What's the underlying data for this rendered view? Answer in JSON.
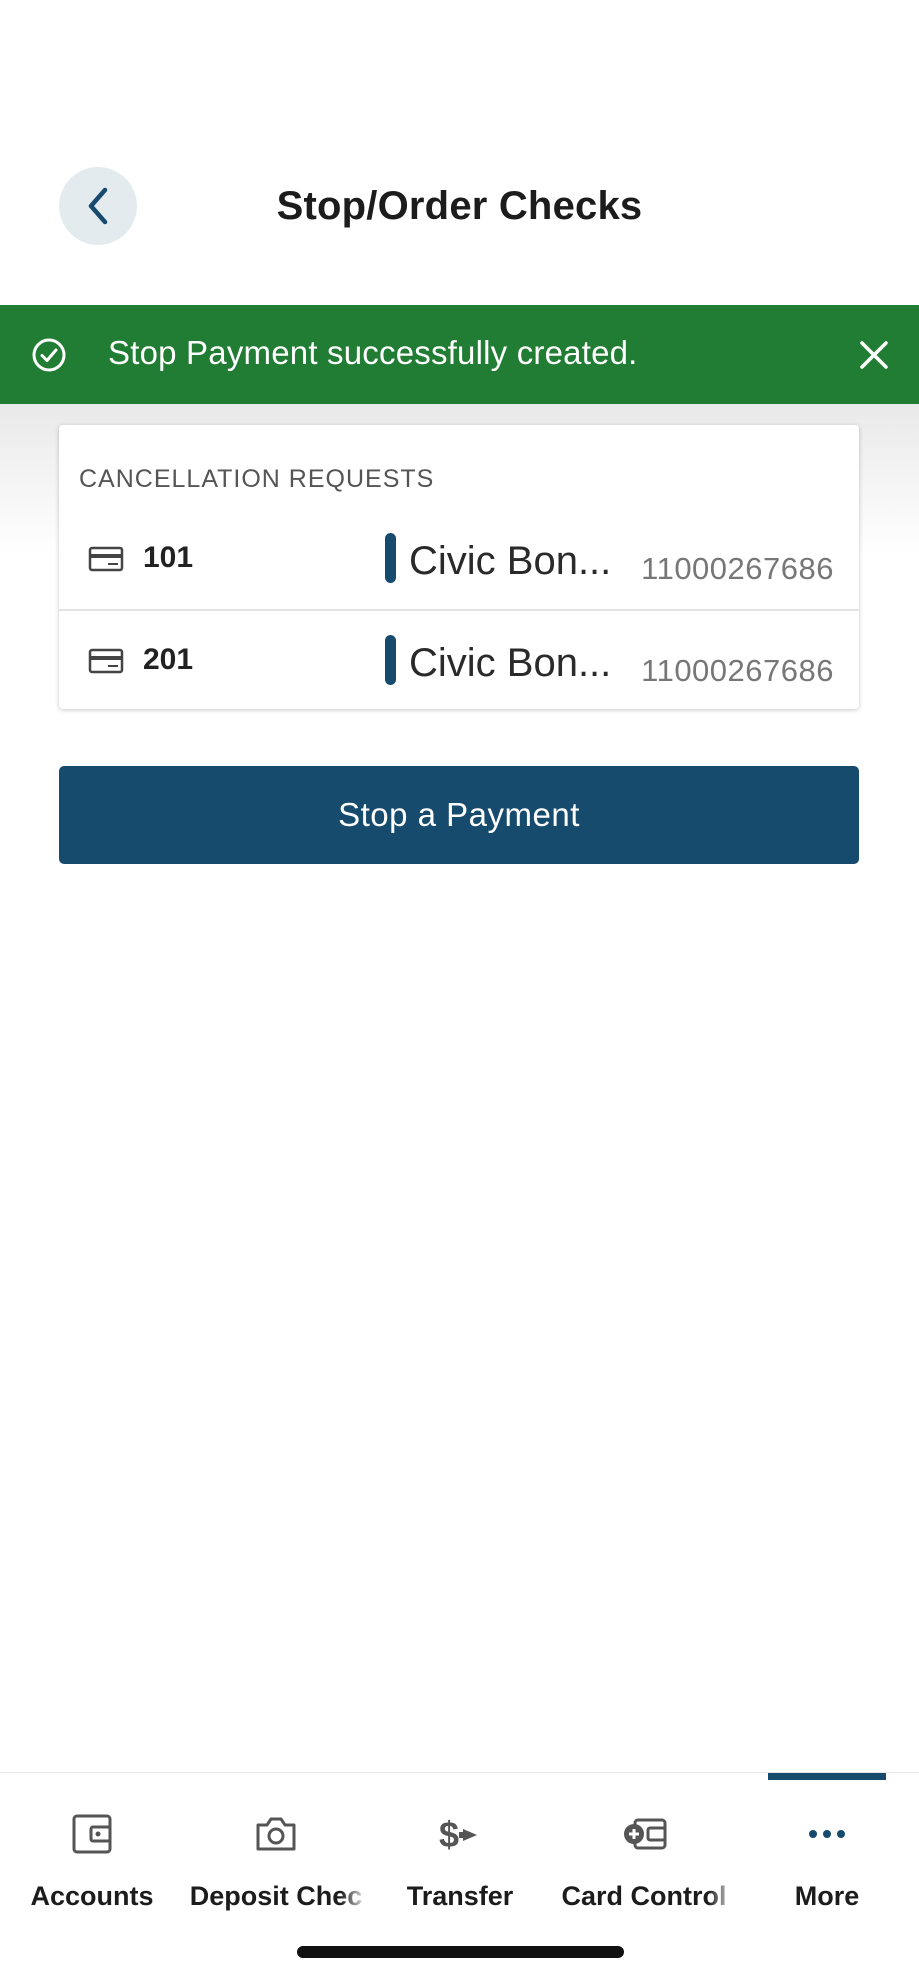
{
  "header": {
    "title": "Stop/Order Checks",
    "back_icon": "chevron-left-icon"
  },
  "banner": {
    "message": "Stop Payment successfully created.",
    "color": "#217d34",
    "status_icon": "check-circle-icon",
    "close_icon": "close-icon"
  },
  "cancellation": {
    "header": "CANCELLATION REQUESTS",
    "rows": [
      {
        "check_number": "101",
        "account_name": "Civic Bon...",
        "account_number": "11000267686"
      },
      {
        "check_number": "201",
        "account_name": "Civic Bon...",
        "account_number": "11000267686"
      }
    ]
  },
  "actions": {
    "stop_payment_label": "Stop a Payment"
  },
  "tabbar": {
    "tabs": [
      {
        "label": "Accounts",
        "icon": "wallet-icon"
      },
      {
        "label": "Deposit Chec",
        "icon": "camera-icon"
      },
      {
        "label": "Transfer",
        "icon": "dollar-transfer-icon"
      },
      {
        "label": "Card Control",
        "icon": "card-control-icon"
      },
      {
        "label": "More",
        "icon": "more-dots-icon"
      }
    ],
    "active": "More"
  },
  "colors": {
    "primary": "#174b6e",
    "success": "#217d34",
    "back_button_bg": "#e4ebef"
  }
}
